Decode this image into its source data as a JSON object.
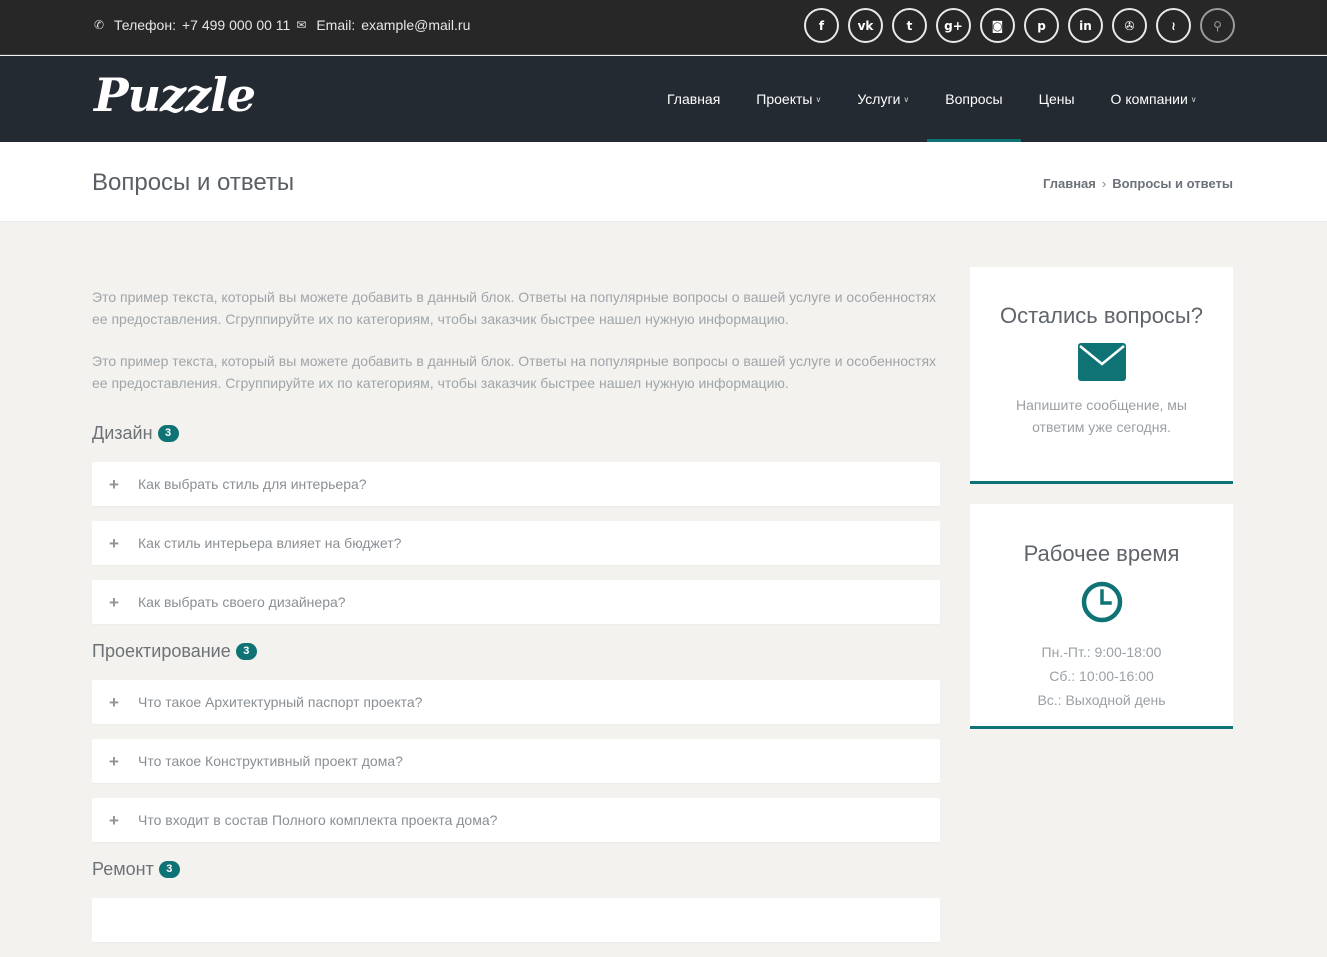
{
  "topbar": {
    "phone_label": "Телефон:",
    "phone": "+7 499 000 00 11",
    "email_label": "Email:",
    "email": "example@mail.ru",
    "socials": [
      {
        "icon": "facebook-icon",
        "glyph": "f"
      },
      {
        "icon": "vk-icon",
        "glyph": "vk"
      },
      {
        "icon": "twitter-icon",
        "glyph": "t"
      },
      {
        "icon": "google-plus-icon",
        "glyph": "g+"
      },
      {
        "icon": "instagram-icon",
        "glyph": "◙"
      },
      {
        "icon": "pinterest-icon",
        "glyph": "p"
      },
      {
        "icon": "linkedin-icon",
        "glyph": "in"
      },
      {
        "icon": "dribbble-icon",
        "glyph": "✇"
      },
      {
        "icon": "rss-icon",
        "glyph": "≀"
      }
    ]
  },
  "header": {
    "logo": "Puzzle",
    "nav": [
      {
        "label": "Главная",
        "dropdown": false,
        "active": false
      },
      {
        "label": "Проекты",
        "dropdown": true,
        "active": false
      },
      {
        "label": "Услуги",
        "dropdown": true,
        "active": false
      },
      {
        "label": "Вопросы",
        "dropdown": false,
        "active": true
      },
      {
        "label": "Цены",
        "dropdown": false,
        "active": false
      },
      {
        "label": "О компании",
        "dropdown": true,
        "active": false
      }
    ]
  },
  "titlebar": {
    "title": "Вопросы и ответы",
    "breadcrumb": [
      "Главная",
      "Вопросы и ответы"
    ]
  },
  "main": {
    "intro": [
      "Это пример текста, который вы можете добавить в данный блок. Ответы на популярные вопросы о вашей услуге и особенностях ее предоставления. Сгруппируйте их по категориям, чтобы заказчик быстрее нашел нужную информацию.",
      "Это пример текста, который вы можете добавить в данный блок. Ответы на популярные вопросы о вашей услуге и особенностях ее предоставления. Сгруппируйте их по категориям, чтобы заказчик быстрее нашел нужную информацию."
    ],
    "sections": [
      {
        "title": "Дизайн",
        "count": "3",
        "questions": [
          "Как выбрать стиль для интерьера?",
          "Как стиль интерьера влияет на бюджет?",
          "Как выбрать своего дизайнера?"
        ]
      },
      {
        "title": "Проектирование",
        "count": "3",
        "questions": [
          "Что такое Архитектурный паспорт проекта?",
          "Что такое Конструктивный проект дома?",
          "Что входит в состав Полного комплекта проекта дома?"
        ]
      },
      {
        "title": "Ремонт",
        "count": "3",
        "questions": [
          ""
        ]
      }
    ]
  },
  "sidebar": {
    "contact": {
      "title": "Остались вопросы?",
      "icon": "envelope-icon",
      "text_line1": "Напишите сообщение, мы",
      "text_line2": "ответим уже сегодня."
    },
    "hours": {
      "title": "Рабочее время",
      "icon": "clock-icon",
      "lines": [
        "Пн.-Пт.: 9:00-18:00",
        "Сб.: 10:00-16:00",
        "Вс.: Выходной день"
      ]
    }
  },
  "colors": {
    "accent": "#0f7375",
    "topbar_bg": "#272727",
    "header_bg": "#232a31",
    "page_bg": "#f3f2ef"
  }
}
